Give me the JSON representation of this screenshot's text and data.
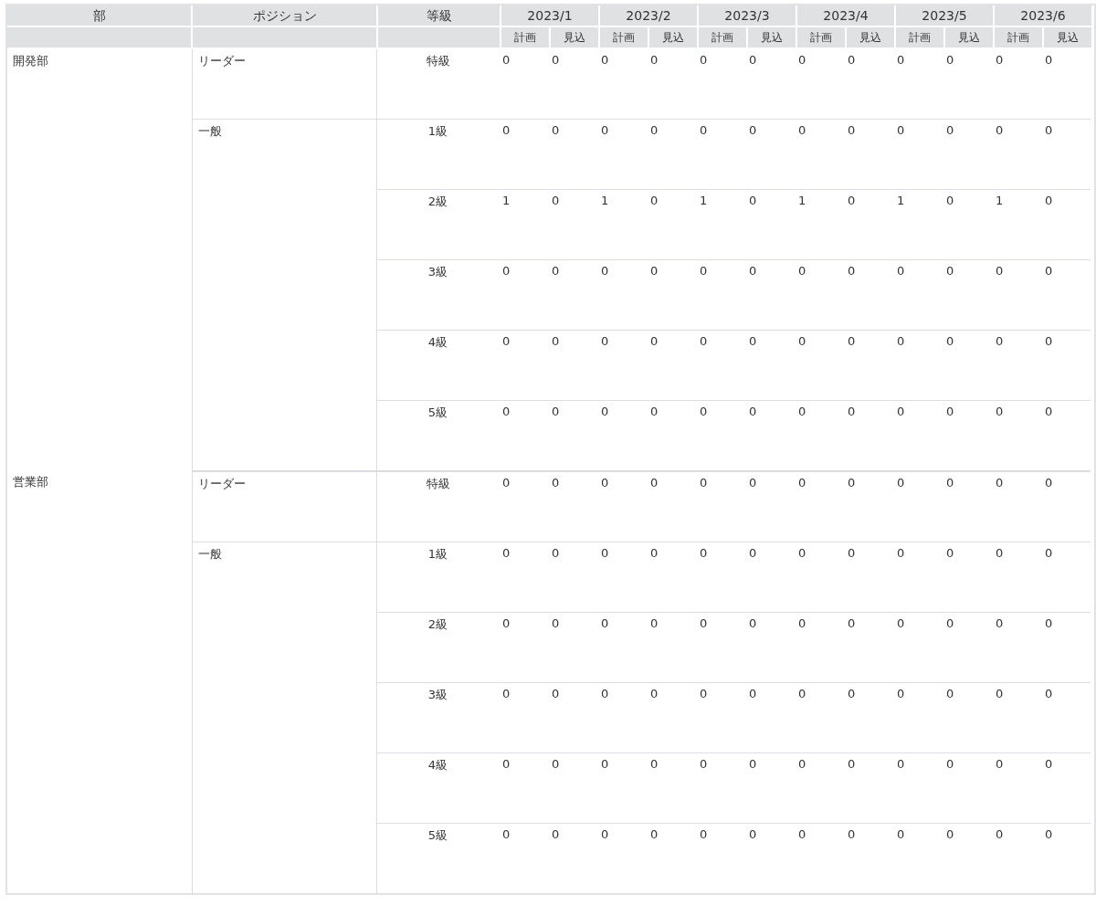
{
  "header": {
    "department": "部",
    "position": "ポジション",
    "grade": "等級",
    "months": [
      {
        "label": "2023/1",
        "sub": [
          "計画",
          "見込"
        ]
      },
      {
        "label": "2023/2",
        "sub": [
          "計画",
          "見込"
        ]
      },
      {
        "label": "2023/3",
        "sub": [
          "計画",
          "見込"
        ]
      },
      {
        "label": "2023/4",
        "sub": [
          "計画",
          "見込"
        ]
      },
      {
        "label": "2023/5",
        "sub": [
          "計画",
          "見込"
        ]
      },
      {
        "label": "2023/6",
        "sub": [
          "計画",
          "見込"
        ]
      }
    ]
  },
  "departments": [
    {
      "name": "開発部",
      "positions": [
        {
          "name": "リーダー",
          "grades": [
            {
              "grade": "特級",
              "values": [
                "0",
                "0",
                "0",
                "0",
                "0",
                "0",
                "0",
                "0",
                "0",
                "0",
                "0",
                "0"
              ]
            }
          ]
        },
        {
          "name": "一般",
          "grades": [
            {
              "grade": "1級",
              "values": [
                "0",
                "0",
                "0",
                "0",
                "0",
                "0",
                "0",
                "0",
                "0",
                "0",
                "0",
                "0"
              ]
            },
            {
              "grade": "2級",
              "values": [
                "1",
                "0",
                "1",
                "0",
                "1",
                "0",
                "1",
                "0",
                "1",
                "0",
                "1",
                "0"
              ]
            },
            {
              "grade": "3級",
              "values": [
                "0",
                "0",
                "0",
                "0",
                "0",
                "0",
                "0",
                "0",
                "0",
                "0",
                "0",
                "0"
              ]
            },
            {
              "grade": "4級",
              "values": [
                "0",
                "0",
                "0",
                "0",
                "0",
                "0",
                "0",
                "0",
                "0",
                "0",
                "0",
                "0"
              ]
            },
            {
              "grade": "5級",
              "values": [
                "0",
                "0",
                "0",
                "0",
                "0",
                "0",
                "0",
                "0",
                "0",
                "0",
                "0",
                "0"
              ]
            }
          ]
        }
      ]
    },
    {
      "name": "営業部",
      "positions": [
        {
          "name": "リーダー",
          "grades": [
            {
              "grade": "特級",
              "values": [
                "0",
                "0",
                "0",
                "0",
                "0",
                "0",
                "0",
                "0",
                "0",
                "0",
                "0",
                "0"
              ]
            }
          ]
        },
        {
          "name": "一般",
          "grades": [
            {
              "grade": "1級",
              "values": [
                "0",
                "0",
                "0",
                "0",
                "0",
                "0",
                "0",
                "0",
                "0",
                "0",
                "0",
                "0"
              ]
            },
            {
              "grade": "2級",
              "values": [
                "0",
                "0",
                "0",
                "0",
                "0",
                "0",
                "0",
                "0",
                "0",
                "0",
                "0",
                "0"
              ]
            },
            {
              "grade": "3級",
              "values": [
                "0",
                "0",
                "0",
                "0",
                "0",
                "0",
                "0",
                "0",
                "0",
                "0",
                "0",
                "0"
              ]
            },
            {
              "grade": "4級",
              "values": [
                "0",
                "0",
                "0",
                "0",
                "0",
                "0",
                "0",
                "0",
                "0",
                "0",
                "0",
                "0"
              ]
            },
            {
              "grade": "5級",
              "values": [
                "0",
                "0",
                "0",
                "0",
                "0",
                "0",
                "0",
                "0",
                "0",
                "0",
                "0",
                "0"
              ]
            }
          ]
        }
      ]
    }
  ]
}
